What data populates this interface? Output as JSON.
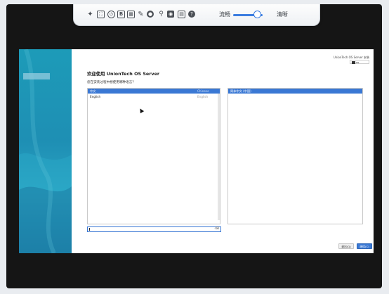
{
  "toolbar": {
    "icons": [
      "pin-icon",
      "fullscreen-icon",
      "power-icon",
      "b-icon",
      "keyboard-icon",
      "mouse-icon",
      "record-icon",
      "usb-icon",
      "camera-icon",
      "display-icon",
      "help-icon"
    ],
    "quality_left": "流畅",
    "quality_right": "清晰",
    "quality_level": 0.82
  },
  "installer": {
    "product_title": "UnionTech OS Server 安装",
    "keyboard_layout": "us",
    "welcome": "欢迎使用 UnionTech OS Server",
    "prompt": "您在安装过程中想使用哪种语言？",
    "languages": [
      {
        "native": "中文",
        "english": "Chinese",
        "selected": true
      },
      {
        "native": "English",
        "english": "English",
        "selected": false
      }
    ],
    "locales": [
      {
        "label": "简体中文 (中国)",
        "selected": true
      }
    ],
    "search_value": "",
    "quit_button": "退出(Q)",
    "continue_button": "继续(C)"
  },
  "colors": {
    "accent": "#3a78d4",
    "side_panel": "#1e8fb4",
    "frame": "#151515"
  }
}
